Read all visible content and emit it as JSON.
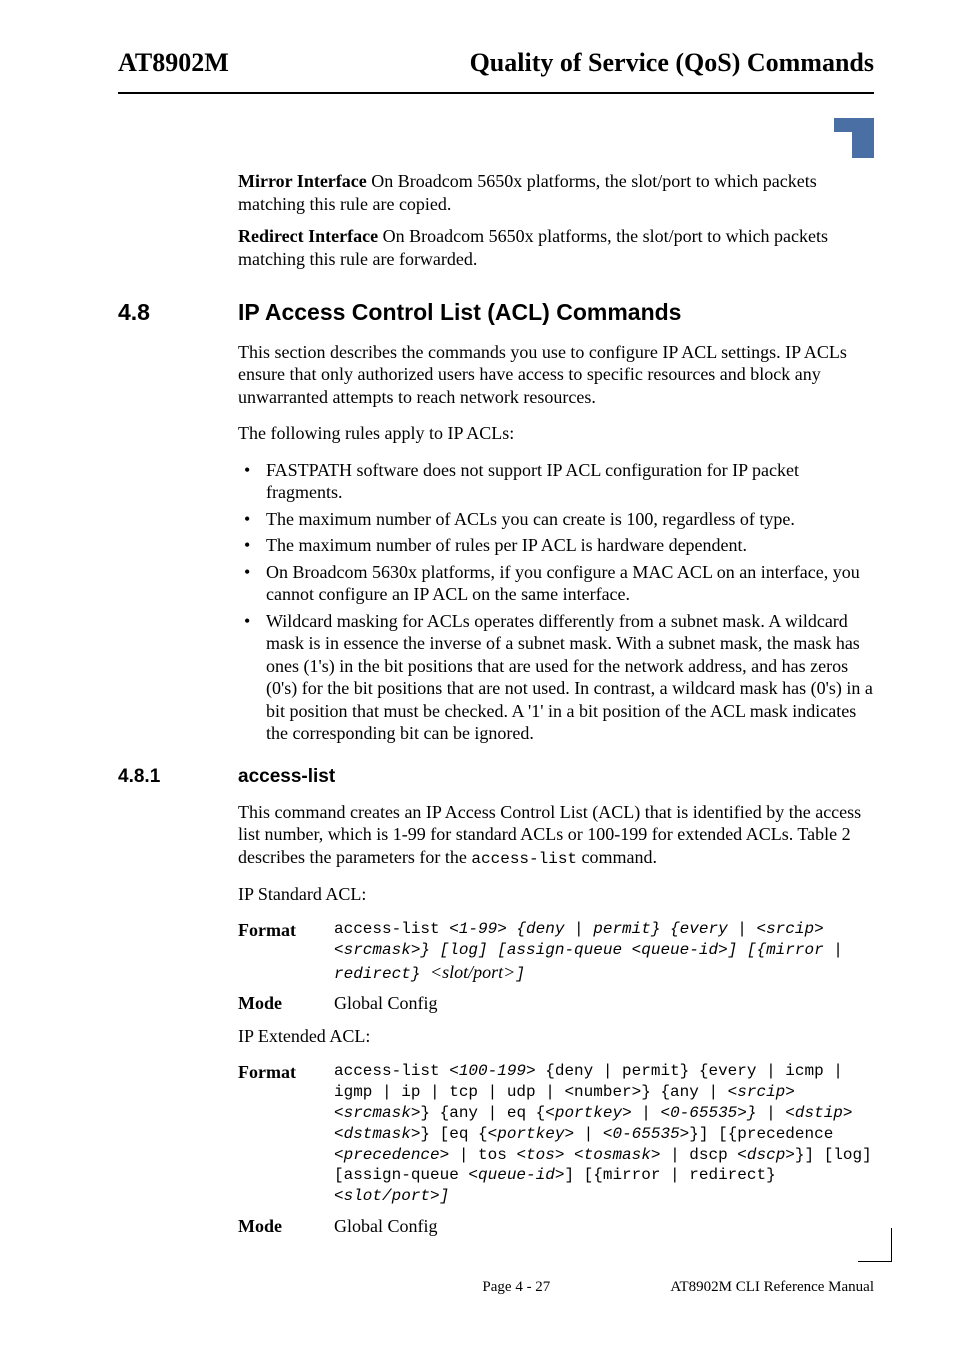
{
  "header": {
    "left": "AT8902M",
    "right": "Quality of Service (QoS) Commands"
  },
  "definitions": [
    {
      "label": "Mirror Interface",
      "text": "  On Broadcom 5650x platforms, the slot/port to which packets matching this rule are copied."
    },
    {
      "label": "Redirect Interface",
      "text": "  On Broadcom 5650x platforms, the slot/port to which packets matching this rule are forwarded."
    }
  ],
  "section": {
    "num": "4.8",
    "title": "IP Access Control List (ACL) Commands",
    "intro": "This section describes the commands you use to configure IP ACL settings. IP ACLs ensure that only authorized users have access to specific resources and block any unwarranted attempts to reach network resources.",
    "rules_lead": "The following rules apply to IP ACLs:",
    "bullets": [
      "FASTPATH software does not support IP ACL configuration for IP packet fragments.",
      "The maximum number of ACLs you can create is 100, regardless of type.",
      "The maximum number of rules per IP ACL is hardware dependent.",
      "On Broadcom 5630x platforms, if you configure a MAC ACL on an interface, you cannot configure an IP ACL on the same interface.",
      "Wildcard masking for ACLs operates differently from a subnet mask. A wildcard mask is in essence the inverse of a subnet mask. With a subnet mask, the mask has ones (1's) in the bit positions that are used for the network address, and has zeros (0's) for the bit positions that are not used. In contrast, a wildcard mask has (0's) in a bit position that must be checked. A '1' in a bit position of the ACL mask indicates the corresponding bit can be ignored."
    ]
  },
  "subsection": {
    "num": "4.8.1",
    "title": "access-list",
    "desc_pre": "This command creates an IP Access Control List (ACL) that is identified by the access list number, which is 1-99 for standard ACLs or 100-199 for extended ACLs. Table 2 describes the parameters for the ",
    "desc_code": "access-list",
    "desc_post": " command.",
    "std_label": "IP Standard ACL:",
    "ext_label": "IP Extended ACL:",
    "format_label": "Format",
    "mode_label": "Mode",
    "mode_value": "Global Config",
    "std_format": {
      "plain1": "access-list ",
      "ital1": "<1-99> {deny | permit} {every | <srcip> <srcmask>} [log] [assign-queue <queue-id>] [{mirror | redirect} ",
      "serif_ital": "<slot/port>",
      "ital2": "]"
    },
    "ext_format": {
      "p1": "access-list ",
      "i1": "<100-199>",
      "p2": " {deny | permit} {every | icmp | igmp | ip | tcp | udp | <number>} {any | ",
      "i2": "<srcip> <srcmask>",
      "p3": "} {any | eq {",
      "i3": "<portkey> | <0-65535>} | <dstip> <dstmask>",
      "p4": "} [eq {",
      "i4": "<portkey> | <0-65535>",
      "p5": "}] [{precedence ",
      "i5": "<precedence> |",
      "p6": " tos ",
      "i6": "<tos> <tosmask> |",
      "p7": " dscp ",
      "i7": "<dscp>",
      "p8": "}] [log] [assign-queue ",
      "i8": "<queue-id>",
      "p9": "] [{mirror | redirect} ",
      "i9": "<slot/port",
      "p10": ">]"
    }
  },
  "footer": {
    "center": "Page 4 - 27",
    "right": "AT8902M CLI Reference Manual"
  }
}
